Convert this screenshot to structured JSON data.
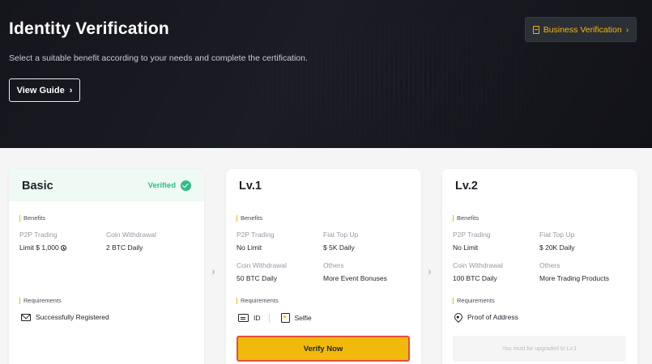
{
  "header": {
    "title": "Identity Verification",
    "subtitle": "Select a suitable benefit according to your needs and complete the certification.",
    "guide_button": "View Guide",
    "business_button": "Business Verification"
  },
  "cards": [
    {
      "level": "Basic",
      "status": "Verified",
      "benefits_label": "Benefits",
      "benefits": [
        {
          "key": "P2P Trading",
          "value": "Limit $ 1,000"
        },
        {
          "key": "Coin Withdrawal",
          "value": "2 BTC Daily"
        }
      ],
      "requirements_label": "Requirements",
      "requirements": [
        {
          "icon": "mail-icon",
          "label": "Successfully Registered"
        }
      ]
    },
    {
      "level": "Lv.1",
      "benefits_label": "Benefits",
      "benefits": [
        {
          "key": "P2P Trading",
          "value": "No Limit"
        },
        {
          "key": "Fiat Top Up",
          "value": "$ 5K Daily"
        },
        {
          "key": "Coin Withdrawal",
          "value": "50 BTC Daily"
        },
        {
          "key": "Others",
          "value": "More Event Bonuses"
        }
      ],
      "requirements_label": "Requirements",
      "requirements": [
        {
          "icon": "id-icon",
          "label": "ID"
        },
        {
          "icon": "selfie-icon",
          "label": "Selfie"
        }
      ],
      "action": "Verify Now"
    },
    {
      "level": "Lv.2",
      "benefits_label": "Benefits",
      "benefits": [
        {
          "key": "P2P Trading",
          "value": "No Limit"
        },
        {
          "key": "Fiat Top Up",
          "value": "$ 20K Daily"
        },
        {
          "key": "Coin Withdrawal",
          "value": "100 BTC Daily"
        },
        {
          "key": "Others",
          "value": "More Trading Products"
        }
      ],
      "requirements_label": "Requirements",
      "requirements": [
        {
          "icon": "pin-icon",
          "label": "Proof of Address"
        }
      ],
      "hint": "You must be upgraded to Lv.1"
    }
  ],
  "colors": {
    "accent": "#f0b90b",
    "verified": "#2ebd85",
    "hero_bg": "#15161c",
    "highlight_border": "#e2513c"
  }
}
